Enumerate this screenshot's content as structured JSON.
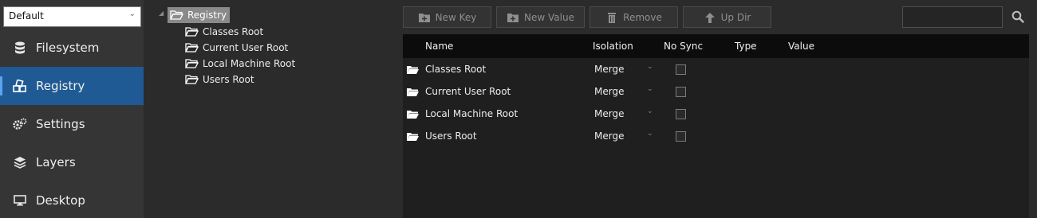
{
  "sidebar": {
    "profile": {
      "value": "Default"
    },
    "items": [
      {
        "label": "Filesystem",
        "icon": "database-icon",
        "active": false
      },
      {
        "label": "Registry",
        "icon": "registry-icon",
        "active": true
      },
      {
        "label": "Settings",
        "icon": "gears-icon",
        "active": false
      },
      {
        "label": "Layers",
        "icon": "layers-icon",
        "active": false
      },
      {
        "label": "Desktop",
        "icon": "monitor-icon",
        "active": false
      }
    ]
  },
  "tree": {
    "root": {
      "label": "Registry"
    },
    "children": [
      {
        "label": "Classes Root"
      },
      {
        "label": "Current User Root"
      },
      {
        "label": "Local Machine Root"
      },
      {
        "label": "Users Root"
      }
    ]
  },
  "toolbar": {
    "new_key": "New Key",
    "new_value": "New Value",
    "remove": "Remove",
    "up_dir": "Up Dir",
    "search_value": ""
  },
  "table": {
    "columns": {
      "name": "Name",
      "isolation": "Isolation",
      "no_sync": "No Sync",
      "type": "Type",
      "value": "Value"
    },
    "rows": [
      {
        "name": "Classes Root",
        "isolation": "Merge",
        "no_sync": false,
        "type": "",
        "value": ""
      },
      {
        "name": "Current User Root",
        "isolation": "Merge",
        "no_sync": false,
        "type": "",
        "value": ""
      },
      {
        "name": "Local Machine Root",
        "isolation": "Merge",
        "no_sync": false,
        "type": "",
        "value": ""
      },
      {
        "name": "Users Root",
        "isolation": "Merge",
        "no_sync": false,
        "type": "",
        "value": ""
      }
    ]
  },
  "colors": {
    "sidebar_bg": "#353535",
    "active_bg": "#1f5a94",
    "table_bg": "#1f1f1f",
    "header_bg": "#0c0c0c"
  }
}
